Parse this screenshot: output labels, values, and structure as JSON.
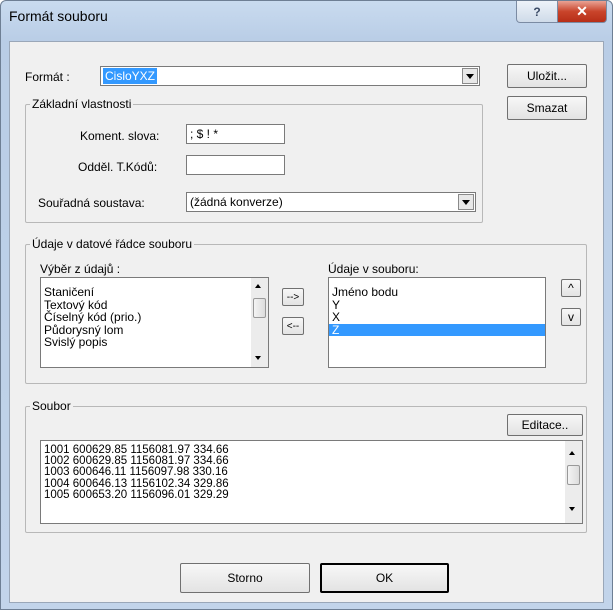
{
  "window": {
    "title": "Formát souboru",
    "help_label": "?",
    "close_label": "✕"
  },
  "format": {
    "label": "Formát :",
    "value": "CisloYXZ"
  },
  "buttons": {
    "save": "Uložit...",
    "delete": "Smazat",
    "move_right": "-->",
    "move_left": "<--",
    "move_up": "^",
    "move_down": "v",
    "edit": "Editace..",
    "cancel": "Storno",
    "ok": "OK"
  },
  "basic": {
    "legend": "Základní vlastnosti",
    "comment_label": "Koment. slova:",
    "comment_value": "; $ ! *",
    "separator_label": "Odděl. T.Kódů:",
    "separator_value": "",
    "coord_label": "Souřadná soustava:",
    "coord_value": "(žádná konverze)"
  },
  "data_line": {
    "legend": "Údaje v datové řádce souboru",
    "available_label": "Výběr z údajů :",
    "available_items": [
      "Staničení",
      "Textový kód",
      "Číselný kód (prio.)",
      "Půdorysný lom",
      "Svislý popis"
    ],
    "file_label": "Údaje v souboru:",
    "file_items": [
      "Jméno bodu",
      "Y",
      "X",
      "Z"
    ],
    "selected_index": 3
  },
  "file": {
    "legend": "Soubor",
    "lines": [
      "1001 600629.85 1156081.97 334.66",
      "1002 600629.85 1156081.97 334.66",
      "1003 600646.11 1156097.98 330.16",
      "1004 600646.13 1156102.34 329.86",
      "1005 600653.20 1156096.01 329.29"
    ]
  },
  "colors": {
    "selection": "#3399ff",
    "close_button": "#c9442b",
    "dialog_bg": "#f0f0f0"
  }
}
